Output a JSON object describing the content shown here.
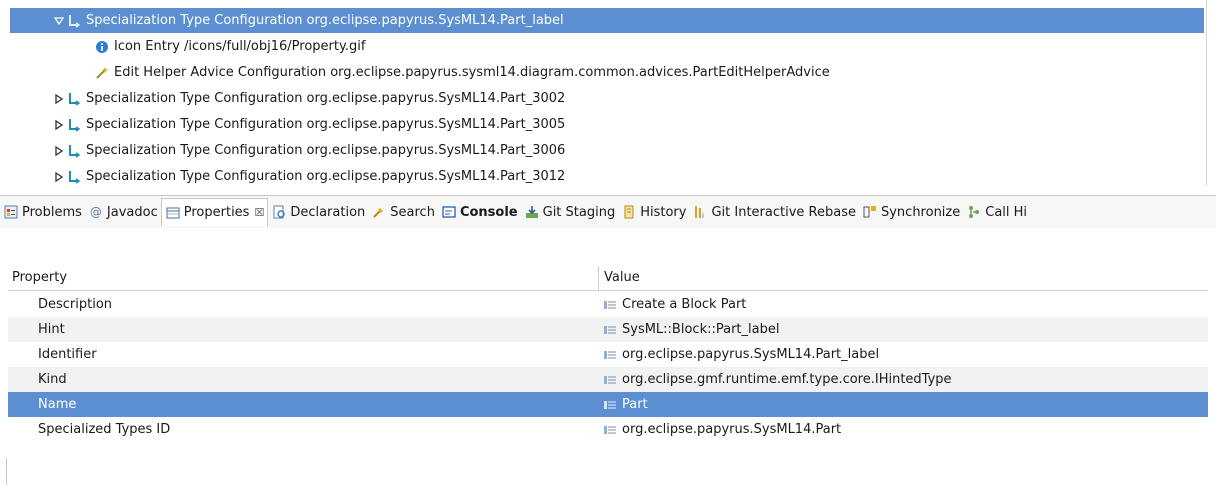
{
  "tree": {
    "rows": [
      {
        "text": "Specialization Type Configuration org.eclipse.papyrus.SysML14.Part_label",
        "twisty": "expanded",
        "icon": "specialization-type-icon",
        "selected": true
      },
      {
        "text": "Icon Entry /icons/full/obj16/Property.gif",
        "twisty": "none",
        "icon": "info-icon",
        "selected": false
      },
      {
        "text": "Edit Helper Advice Configuration org.eclipse.papyrus.sysml14.diagram.common.advices.PartEditHelperAdvice",
        "twisty": "none",
        "icon": "wand-icon",
        "selected": false
      },
      {
        "text": "Specialization Type Configuration org.eclipse.papyrus.SysML14.Part_3002",
        "twisty": "collapsed",
        "icon": "specialization-type-icon",
        "selected": false
      },
      {
        "text": "Specialization Type Configuration org.eclipse.papyrus.SysML14.Part_3005",
        "twisty": "collapsed",
        "icon": "specialization-type-icon",
        "selected": false
      },
      {
        "text": "Specialization Type Configuration org.eclipse.papyrus.SysML14.Part_3006",
        "twisty": "collapsed",
        "icon": "specialization-type-icon",
        "selected": false
      },
      {
        "text": "Specialization Type Configuration org.eclipse.papyrus.SysML14.Part_3012",
        "twisty": "collapsed",
        "icon": "specialization-type-icon",
        "selected": false
      }
    ]
  },
  "tabs": {
    "problems": "Problems",
    "javadoc": "Javadoc",
    "properties": "Properties",
    "properties_close": "☒",
    "declaration": "Declaration",
    "search": "Search",
    "console": "Console",
    "git_staging": "Git Staging",
    "history": "History",
    "git_rebase": "Git Interactive Rebase",
    "synchronize": "Synchronize",
    "call_hierarchy": "Call Hi"
  },
  "properties": {
    "col_property": "Property",
    "col_value": "Value",
    "rows": [
      {
        "name": "Description",
        "value": "Create a Block Part"
      },
      {
        "name": "Hint",
        "value": "SysML::Block::Part_label"
      },
      {
        "name": "Identifier",
        "value": "org.eclipse.papyrus.SysML14.Part_label"
      },
      {
        "name": "Kind",
        "value": "org.eclipse.gmf.runtime.emf.type.core.IHintedType"
      },
      {
        "name": "Name",
        "value": "Part"
      },
      {
        "name": "Specialized Types ID",
        "value": "org.eclipse.papyrus.SysML14.Part"
      }
    ]
  },
  "colors": {
    "selection": "#5b8fd1",
    "alt_row": "#f2f2f2"
  }
}
